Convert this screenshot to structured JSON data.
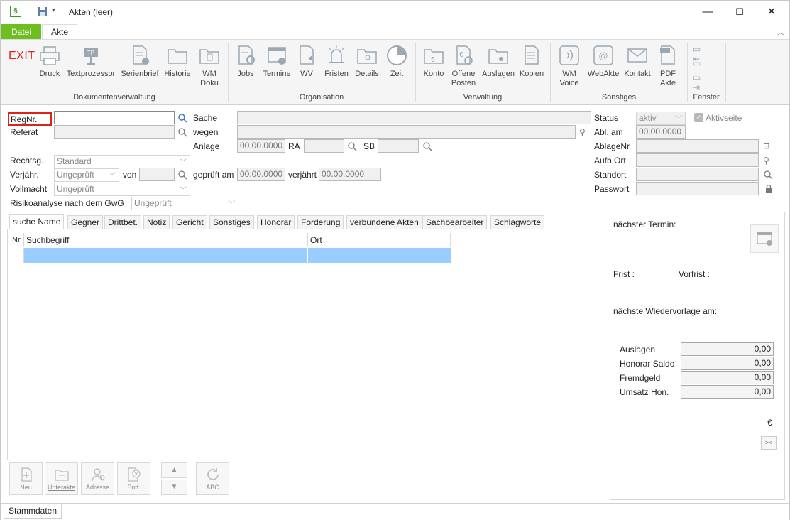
{
  "window": {
    "title": "Akten (leer)",
    "minimize": "—",
    "maximize": "☐",
    "close": "✕"
  },
  "tabs": {
    "file": "Datei",
    "akte": "Akte"
  },
  "ribbon": {
    "exit": "EXIT",
    "groups": [
      "Dokumentenverwaltung",
      "Organisation",
      "Verwaltung",
      "Sonstiges",
      "Fenster"
    ],
    "buttons": {
      "druck": "Druck",
      "textprozessor": "Textprozessor",
      "serienbrief": "Serienbrief",
      "historie": "Historie",
      "wmdoku1": "WM",
      "wmdoku2": "Doku",
      "jobs": "Jobs",
      "termine": "Termine",
      "wv": "WV",
      "fristen": "Fristen",
      "details": "Details",
      "zeit": "Zeit",
      "konto": "Konto",
      "offene1": "Offene",
      "offene2": "Posten",
      "auslagen": "Auslagen",
      "kopien": "Kopien",
      "wmvoice1": "WM",
      "wmvoice2": "Voice",
      "webakte": "WebAkte",
      "kontakt": "Kontakt",
      "pdf1": "PDF",
      "pdf2": "Akte"
    }
  },
  "form": {
    "regnr": "RegNr.",
    "referat": "Referat",
    "sache": "Sache",
    "wegen": "wegen",
    "anlage": "Anlage",
    "anlage_val": "00.00.0000",
    "ra": "RA",
    "sb": "SB",
    "status": "Status",
    "status_val": "aktiv",
    "aktivseite": "Aktivseite",
    "abl_am": "Abl. am",
    "abl_val": "00.00.0000",
    "ablagenr": "AblageNr",
    "aufb_ort": "Aufb.Ort",
    "standort": "Standort",
    "passwort": "Passwort",
    "rechtsg": "Rechtsg.",
    "rechtsg_val": "Standard",
    "verjaehr": "Verjähr.",
    "verjaehr_val": "Ungeprüft",
    "von": "von",
    "geprueft_am": "geprüft am",
    "geprueft_val": "00.00.0000",
    "verjaehrt": "verjährt",
    "verjaehrt_val": "00.00.0000",
    "vollmacht": "Vollmacht",
    "vollmacht_val": "Ungeprüft",
    "gwg": "Risikoanalyse nach dem GwG",
    "gwg_val": "Ungeprüft"
  },
  "lowertabs": [
    "suche Name",
    "Gegner",
    "Drittbet.",
    "Notiz",
    "Gericht",
    "Sonstiges",
    "Honorar",
    "Forderung",
    "verbundene Akten",
    "Sachbearbeiter",
    "Schlagworte"
  ],
  "grid": {
    "nr": "Nr",
    "suchbegriff": "Suchbegriff",
    "ort": "Ort"
  },
  "buttons": {
    "neu": "Neu",
    "unterakte": "Unterakte",
    "adresse": "Adresse",
    "entf": "Entf.",
    "abc": "ABC"
  },
  "right": {
    "naechster_termin": "nächster Termin:",
    "frist": "Frist :",
    "vorfrist": "Vorfrist :",
    "wiedervorlage": "nächste Wiedervorlage am:",
    "auslagen": "Auslagen",
    "auslagen_val": "0,00",
    "honorar_saldo": "Honorar Saldo",
    "honorar_val": "0,00",
    "fremdgeld": "Fremdgeld",
    "fremdgeld_val": "0,00",
    "umsatz": "Umsatz Hon.",
    "umsatz_val": "0,00",
    "euro": "€",
    "swap": "><"
  },
  "status": {
    "stammdaten": "Stammdaten"
  },
  "colors": {
    "accent": "#6cbf1e",
    "selection": "#99ccff",
    "exit": "#d9261c",
    "focus": "#d9261c"
  }
}
